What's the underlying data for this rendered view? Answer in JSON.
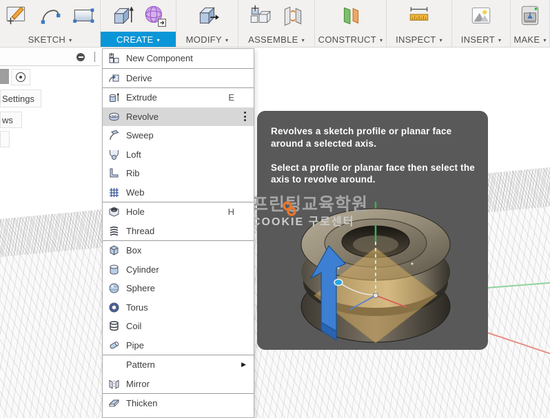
{
  "toolbar": {
    "caret": "▾",
    "groups": [
      {
        "label": "SKETCH",
        "active": false,
        "icons": [
          "create-sketch-icon",
          "arc-icon",
          "rectangle-icon"
        ]
      },
      {
        "label": "CREATE",
        "active": true,
        "icons": [
          "extrude-tool-icon",
          "form-icon"
        ]
      },
      {
        "label": "MODIFY",
        "active": false,
        "icons": [
          "press-pull-icon"
        ]
      },
      {
        "label": "ASSEMBLE",
        "active": false,
        "icons": [
          "new-component-tool-icon",
          "joint-icon"
        ]
      },
      {
        "label": "CONSTRUCT",
        "active": false,
        "icons": [
          "construction-plane-icon"
        ]
      },
      {
        "label": "INSPECT",
        "active": false,
        "icons": [
          "measure-icon"
        ]
      },
      {
        "label": "INSERT",
        "active": false,
        "icons": [
          "insert-image-icon"
        ]
      },
      {
        "label": "MAKE",
        "active": false,
        "icons": [
          "print-3d-icon"
        ]
      }
    ]
  },
  "menu": {
    "submenu_glyph": "▶",
    "items": [
      {
        "label": "New Component",
        "icon": "new-component-icon",
        "separator_after": true
      },
      {
        "label": "Derive",
        "icon": "derive-icon",
        "separator_after": true
      },
      {
        "label": "Extrude",
        "icon": "extrude-icon",
        "shortcut": "E"
      },
      {
        "label": "Revolve",
        "icon": "revolve-icon",
        "highlighted": true,
        "kebab": true
      },
      {
        "label": "Sweep",
        "icon": "sweep-icon"
      },
      {
        "label": "Loft",
        "icon": "loft-icon"
      },
      {
        "label": "Rib",
        "icon": "rib-icon"
      },
      {
        "label": "Web",
        "icon": "web-icon",
        "separator_after": true
      },
      {
        "label": "Hole",
        "icon": "hole-icon",
        "shortcut": "H"
      },
      {
        "label": "Thread",
        "icon": "thread-icon",
        "separator_after": true
      },
      {
        "label": "Box",
        "icon": "box-icon"
      },
      {
        "label": "Cylinder",
        "icon": "cylinder-icon"
      },
      {
        "label": "Sphere",
        "icon": "sphere-icon"
      },
      {
        "label": "Torus",
        "icon": "torus-icon"
      },
      {
        "label": "Coil",
        "icon": "coil-icon"
      },
      {
        "label": "Pipe",
        "icon": "pipe-icon",
        "separator_after": true
      },
      {
        "label": "Pattern",
        "icon": null,
        "submenu": true
      },
      {
        "label": "Mirror",
        "icon": "mirror-icon",
        "separator_after": true
      },
      {
        "label": "Thicken",
        "icon": "thicken-icon"
      }
    ]
  },
  "tooltip": {
    "paragraphs": [
      "Revolves a sketch profile or planar face around a selected axis.",
      "Select a profile or planar face then select the axis to revolve around."
    ]
  },
  "watermark": {
    "line1": "프린팅교육학원",
    "line2": "COOKIE 구로센터",
    "logo_color": "#e8762d"
  },
  "browser": {
    "settings_label": "Settings",
    "views_label": "ws"
  },
  "colors": {
    "accent": "#0a96d7",
    "menu_highlight": "#d7d7d7",
    "tooltip_bg": "#595959",
    "axis_green": "#8fd49b",
    "axis_red": "#e98f85"
  }
}
